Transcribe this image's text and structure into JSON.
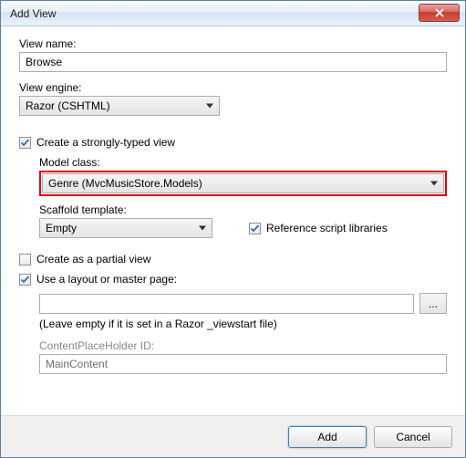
{
  "window": {
    "title": "Add View"
  },
  "viewName": {
    "label": "View name:",
    "value": "Browse"
  },
  "viewEngine": {
    "label": "View engine:",
    "value": "Razor (CSHTML)"
  },
  "stronglyTyped": {
    "label": "Create a strongly-typed view",
    "checked": true
  },
  "modelClass": {
    "label": "Model class:",
    "value": "Genre (MvcMusicStore.Models)"
  },
  "scaffold": {
    "label": "Scaffold template:",
    "value": "Empty"
  },
  "refScript": {
    "label": "Reference script libraries",
    "checked": true
  },
  "partial": {
    "label": "Create as a partial view",
    "checked": false
  },
  "useLayout": {
    "label": "Use a layout or master page:",
    "checked": true,
    "value": ""
  },
  "layoutHint": "(Leave empty if it is set in a Razor _viewstart file)",
  "cph": {
    "label": "ContentPlaceHolder ID:",
    "value": "MainContent"
  },
  "browseBtn": "...",
  "buttons": {
    "add": "Add",
    "cancel": "Cancel"
  }
}
